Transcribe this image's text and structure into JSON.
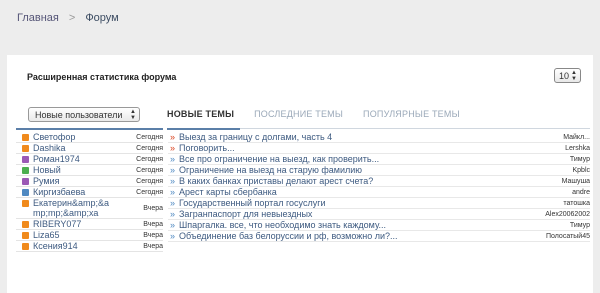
{
  "breadcrumb": {
    "home": "Главная",
    "separator": ">",
    "current": "Форум"
  },
  "stats": {
    "title": "Расширенная статистика форума",
    "per_page": "10"
  },
  "users_select": {
    "selected": "Новые пользователи"
  },
  "tabs": [
    {
      "label": "НОВЫЕ ТЕМЫ",
      "active": true
    },
    {
      "label": "ПОСЛЕДНИЕ ТЕМЫ",
      "active": false
    },
    {
      "label": "ПОПУЛЯРНЫЕ ТЕМЫ",
      "active": false
    }
  ],
  "users": [
    {
      "name": "Светофор",
      "when": "Сегодня",
      "color": "#f08a1c"
    },
    {
      "name": "Dashika",
      "when": "Сегодня",
      "color": "#f08a1c"
    },
    {
      "name": "Роман1974",
      "when": "Сегодня",
      "color": "#9b59b6"
    },
    {
      "name": "Новый",
      "when": "Сегодня",
      "color": "#4caf50"
    },
    {
      "name": "Румия",
      "when": "Сегодня",
      "color": "#9b59b6"
    },
    {
      "name": "Киргизбаева",
      "when": "Сегодня",
      "color": "#4f89c2"
    },
    {
      "name": "Екатерин&amp;&amp;mp;&amp;ха",
      "when": "Вчера",
      "color": "#f08a1c"
    },
    {
      "name": "RIBERY077",
      "when": "Вчера",
      "color": "#f08a1c"
    },
    {
      "name": "Liza65",
      "when": "Вчера",
      "color": "#f08a1c"
    },
    {
      "name": "Ксения914",
      "when": "Вчера",
      "color": "#f08a1c"
    }
  ],
  "topics": [
    {
      "title": "Выезд за границу с долгами, часть 4",
      "author": "Майкл...",
      "hot": true
    },
    {
      "title": "Поговорить...",
      "author": "Lershka",
      "hot": true
    },
    {
      "title": "Все про ограничение на выезд, как проверить...",
      "author": "Тимур",
      "hot": false
    },
    {
      "title": "Ограничение на выезд на старую фамилию",
      "author": "Kpblc",
      "hot": false
    },
    {
      "title": "В каких банках приставы делают арест счета?",
      "author": "Машуша",
      "hot": false
    },
    {
      "title": "Арест карты сбербанка",
      "author": "andre",
      "hot": false
    },
    {
      "title": "Государственный портал госуслуги",
      "author": "татошка",
      "hot": false
    },
    {
      "title": "Загранпаспорт для невыездных",
      "author": "Alex20062002",
      "hot": false
    },
    {
      "title": "Шпаргалка. все, что необходимо знать каждому...",
      "author": "Тимур",
      "hot": false
    },
    {
      "title": "Объединение баз белоруссии и рф, возможно ли?...",
      "author": "Полосатый45",
      "hot": false
    }
  ]
}
